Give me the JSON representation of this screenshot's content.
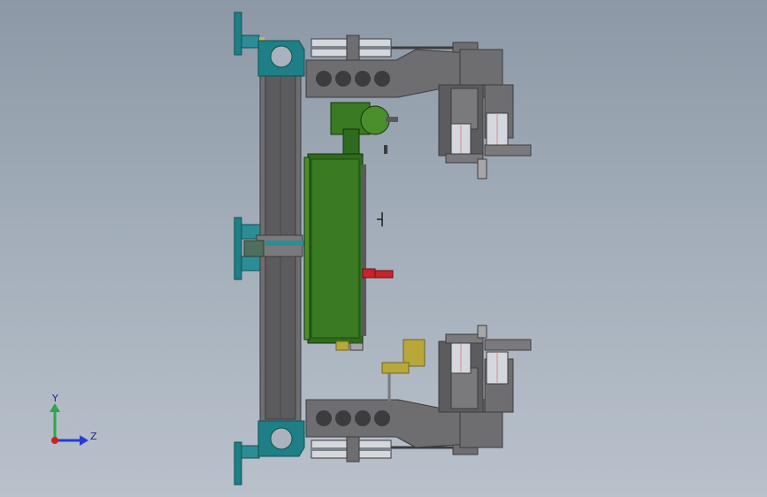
{
  "viewport": {
    "background_top": "#8d98a6",
    "background_bottom": "#b9c1cb"
  },
  "colors": {
    "frame_teal": "#1e7f86",
    "frame_teal_dark": "#0f5056",
    "steel_gray": "#6e6e70",
    "steel_dark": "#3c3c3e",
    "steel_light": "#a6a6a8",
    "motor_green": "#2e6b1c",
    "motor_green_light": "#4a8f2c",
    "cylinder_silver": "#d4d8de",
    "accent_red": "#c8242a",
    "accent_yellow": "#b8a83a",
    "accent_pink": "#d98a8a"
  },
  "triad": {
    "y_label": "Y",
    "z_label": "Z",
    "y_color": "#2aa84a",
    "z_color": "#2a3ad8",
    "origin_color": "#d01f1f"
  }
}
